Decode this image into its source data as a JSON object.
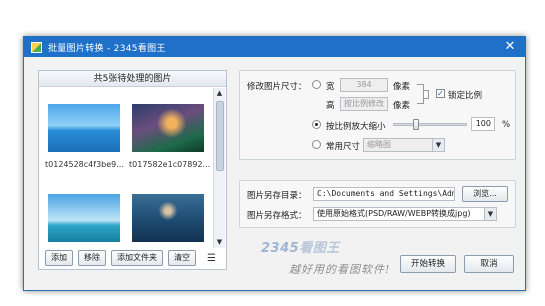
{
  "window": {
    "title": "批量图片转换 - 2345看图王",
    "close_glyph": "✕"
  },
  "left": {
    "header": "共5张待处理的图片",
    "thumbnails": [
      {
        "name": "t0124528c4f3be9..."
      },
      {
        "name": "t017582e1c07892..."
      },
      {
        "name": ""
      },
      {
        "name": ""
      }
    ],
    "buttons": {
      "add": "添加",
      "remove": "移除",
      "add_folder": "添加文件夹",
      "clear": "清空"
    },
    "list_icon": "☰"
  },
  "resize": {
    "title": "修改图片尺寸：",
    "width_label": "宽",
    "width_value": "384",
    "height_label": "高",
    "height_value": "按比例修改",
    "unit": "像素",
    "lock_ratio": "锁定比例",
    "lock_checked": true,
    "scale_label": "按比例放大缩小",
    "scale_value": "100",
    "scale_slider_fraction": 0.31,
    "percent": "%",
    "common_label": "常用尺寸",
    "common_value": "缩略图",
    "selected": "scale"
  },
  "output": {
    "dir_label": "图片另存目录：",
    "dir_value": "C:\\Documents and Settings\\Admini",
    "browse": "浏览...",
    "format_label": "图片另存格式：",
    "format_value": "使用原始格式(PSD/RAW/WEBP转换成jpg)"
  },
  "brand": {
    "logo_num": "2345",
    "logo_text": "看图王",
    "slogan": "越好用的看图软件!"
  },
  "actions": {
    "start": "开始转换",
    "cancel": "取消"
  }
}
